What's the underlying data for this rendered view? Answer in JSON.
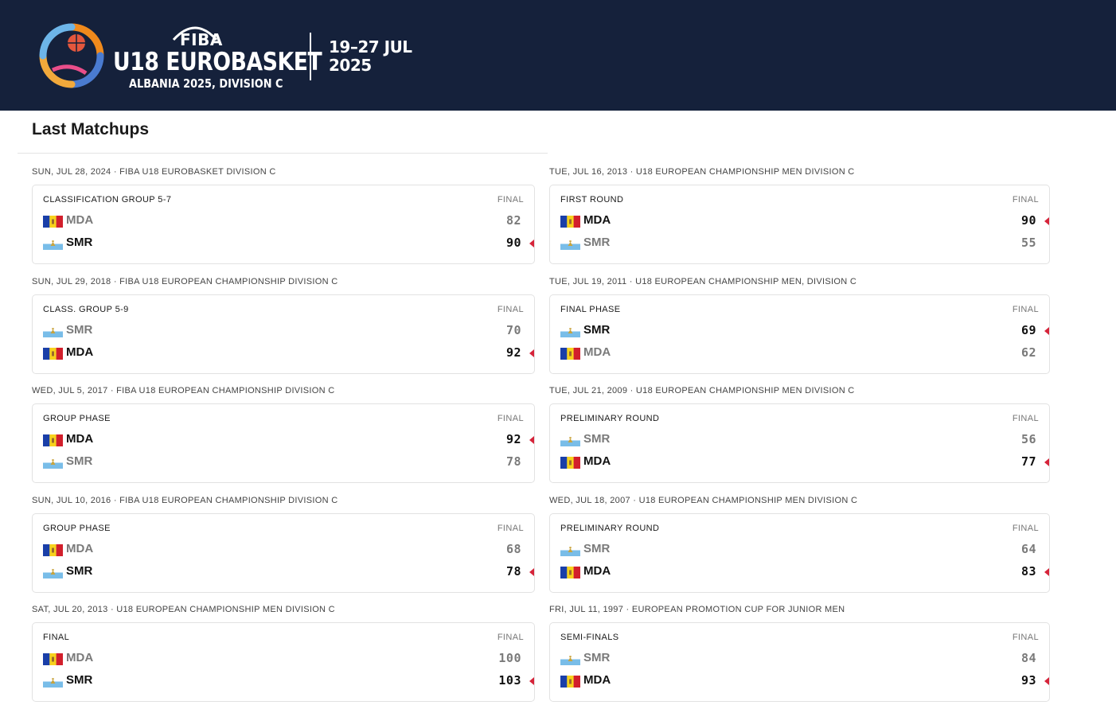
{
  "header": {
    "logo_fiba": "FIBA",
    "logo_title": "U18 EUROBASKET",
    "logo_subtitle": "ALBANIA 2025, DIVISION C",
    "dates_line1": "19–27 JUL",
    "dates_line2": "2025",
    "logo_icon": "basketball-swirl-logo"
  },
  "section": {
    "title": "Last Matchups"
  },
  "colors": {
    "header_bg": "#15213b",
    "winner_arrow": "#d6243a",
    "card_border": "#e2e2e2"
  },
  "flags": {
    "MDA": "moldova-flag-icon",
    "SMR": "san-marino-flag-icon"
  },
  "matches": [
    {
      "date": "SUN, JUL 28, 2024 · FIBA U18 EUROBASKET DIVISION C",
      "round": "CLASSIFICATION GROUP 5-7",
      "status": "FINAL",
      "team1": "MDA",
      "score1": "82",
      "team2": "SMR",
      "score2": "90",
      "winner": 2
    },
    {
      "date": "TUE, JUL 16, 2013 · U18 EUROPEAN CHAMPIONSHIP MEN DIVISION C",
      "round": "FIRST ROUND",
      "status": "FINAL",
      "team1": "MDA",
      "score1": "90",
      "team2": "SMR",
      "score2": "55",
      "winner": 1
    },
    {
      "date": "SUN, JUL 29, 2018 · FIBA U18 EUROPEAN CHAMPIONSHIP DIVISION C",
      "round": "CLASS. GROUP 5-9",
      "status": "FINAL",
      "team1": "SMR",
      "score1": "70",
      "team2": "MDA",
      "score2": "92",
      "winner": 2
    },
    {
      "date": "TUE, JUL 19, 2011 · U18 EUROPEAN CHAMPIONSHIP MEN, DIVISION C",
      "round": "FINAL PHASE",
      "status": "FINAL",
      "team1": "SMR",
      "score1": "69",
      "team2": "MDA",
      "score2": "62",
      "winner": 1
    },
    {
      "date": "WED, JUL 5, 2017 · FIBA U18 EUROPEAN CHAMPIONSHIP DIVISION C",
      "round": "GROUP PHASE",
      "status": "FINAL",
      "team1": "MDA",
      "score1": "92",
      "team2": "SMR",
      "score2": "78",
      "winner": 1
    },
    {
      "date": "TUE, JUL 21, 2009 · U18 EUROPEAN CHAMPIONSHIP MEN DIVISION C",
      "round": "PRELIMINARY ROUND",
      "status": "FINAL",
      "team1": "SMR",
      "score1": "56",
      "team2": "MDA",
      "score2": "77",
      "winner": 2
    },
    {
      "date": "SUN, JUL 10, 2016 · FIBA U18 EUROPEAN CHAMPIONSHIP DIVISION C",
      "round": "GROUP PHASE",
      "status": "FINAL",
      "team1": "MDA",
      "score1": "68",
      "team2": "SMR",
      "score2": "78",
      "winner": 2
    },
    {
      "date": "WED, JUL 18, 2007 · U18 EUROPEAN CHAMPIONSHIP MEN DIVISION C",
      "round": "PRELIMINARY ROUND",
      "status": "FINAL",
      "team1": "SMR",
      "score1": "64",
      "team2": "MDA",
      "score2": "83",
      "winner": 2
    },
    {
      "date": "SAT, JUL 20, 2013 · U18 EUROPEAN CHAMPIONSHIP MEN DIVISION C",
      "round": "FINAL",
      "status": "FINAL",
      "team1": "MDA",
      "score1": "100",
      "team2": "SMR",
      "score2": "103",
      "winner": 2
    },
    {
      "date": "FRI, JUL 11, 1997 · EUROPEAN PROMOTION CUP FOR JUNIOR MEN",
      "round": "SEMI-FINALS",
      "status": "FINAL",
      "team1": "SMR",
      "score1": "84",
      "team2": "MDA",
      "score2": "93",
      "winner": 2
    }
  ]
}
